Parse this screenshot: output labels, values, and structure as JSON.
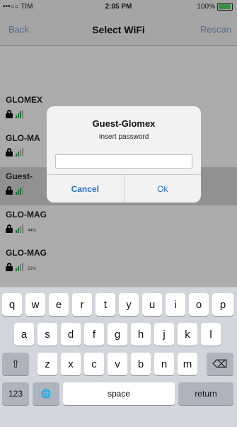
{
  "status_bar": {
    "carrier": "•••○○ TIM",
    "time": "2:05 PM",
    "battery": "100%"
  },
  "nav": {
    "back_label": "Back",
    "title": "Select WiFi",
    "rescan_label": "Rescan"
  },
  "networks": [
    {
      "name": "GLOMEX",
      "signal": "",
      "level": 0.75
    },
    {
      "name": "GLO-MA",
      "signal": "",
      "level": 0.5
    },
    {
      "name": "Guest-",
      "signal": "",
      "level": 0.75
    },
    {
      "name": "GLO-MAG",
      "signal": "44%",
      "level": 0.5
    },
    {
      "name": "GLO-MAG",
      "signal": "51%",
      "level": 0.5
    }
  ],
  "alert": {
    "title": "Guest-Glomex",
    "message": "Insert password",
    "password_value": "",
    "cancel_label": "Cancel",
    "ok_label": "Ok"
  },
  "keyboard": {
    "row1": [
      "q",
      "w",
      "e",
      "r",
      "t",
      "y",
      "u",
      "i",
      "o",
      "p"
    ],
    "row2": [
      "a",
      "s",
      "d",
      "f",
      "g",
      "h",
      "j",
      "k",
      "l"
    ],
    "row3": [
      "z",
      "x",
      "c",
      "v",
      "b",
      "n",
      "m"
    ],
    "shift_icon": "⇧",
    "delete_icon": "⌫",
    "numbers_label": "123",
    "globe_icon": "🌐",
    "space_label": "space",
    "return_label": "return"
  },
  "colors": {
    "accent": "#2a6fc9",
    "signal_green": "#2aa64a",
    "battery_green": "#4cd964"
  }
}
